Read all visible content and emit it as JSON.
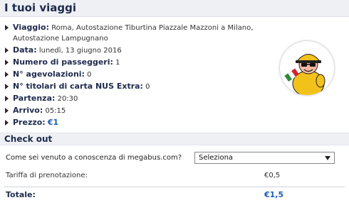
{
  "header": {
    "title": "I tuoi viaggi"
  },
  "trip": {
    "journey_label": "Viaggio:",
    "journey_value": "Roma, Autostazione Tiburtina Piazzale Mazzoni a Milano, Autostazione Lampugnano",
    "date_label": "Data:",
    "date_value": "lunedì, 13 giugno 2016",
    "passengers_label": "Numero di passeggeri:",
    "passengers_value": "1",
    "discounts_label": "N° agevolazioni:",
    "discounts_value": "0",
    "nus_label": "N° titolari di carta NUS Extra:",
    "nus_value": "0",
    "departure_label": "Partenza:",
    "departure_value": "20:30",
    "arrival_label": "Arrivo:",
    "arrival_value": "05:15",
    "price_label": "Prezzo:",
    "price_value": "€1"
  },
  "checkout": {
    "title": "Check out",
    "source_question": "Come sei venuto a conoscenza di megabus.com?",
    "source_select_value": "Seleziona",
    "fee_label": "Tariffa di prenotazione:",
    "fee_value": "€0,5",
    "total_label": "Totale:",
    "total_value": "€1,5"
  },
  "icons": {
    "bullet": "triangle-right-icon",
    "select": "chevron-down-icon",
    "mascot": "megabus-mascot-logo"
  },
  "colors": {
    "heading": "#1f2b4d",
    "price": "#1f5fb0",
    "bar_bg": "#eef0f4"
  }
}
